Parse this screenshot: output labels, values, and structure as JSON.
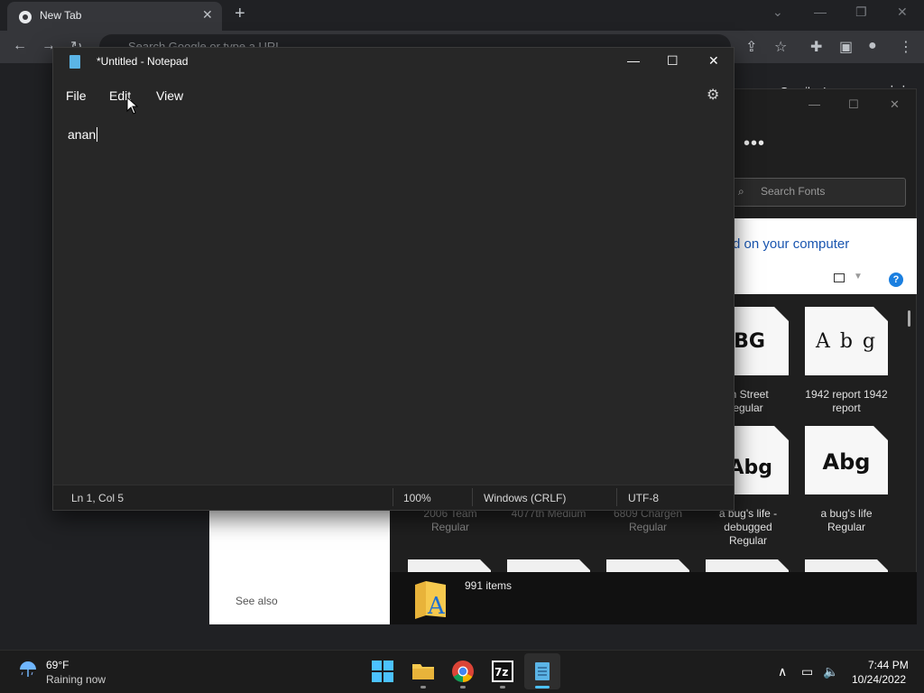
{
  "chrome": {
    "tab_title": "New Tab",
    "omnibox_placeholder": "Search Google or type a URL",
    "ntp_links": [
      "Gmail",
      "Images"
    ]
  },
  "fonts_window": {
    "search_placeholder": "Search Fonts",
    "heading_fragment": "d on your computer",
    "see_also": "See also",
    "items_count": "991 items",
    "tiles_row1": [
      {
        "sample": "ABG",
        "label": "th Street\negular"
      },
      {
        "sample": "A b g",
        "label": "1942 report 1942\nreport"
      }
    ],
    "tiles_row2": [
      {
        "sample": "Abg",
        "label": "a bug's life -\ndebugged\nRegular"
      },
      {
        "sample": "Abg",
        "label": "a bug's life\nRegular"
      }
    ],
    "behind_labels": [
      "2006 Team\nRegular",
      "4077th Medium",
      "6809 Chargen\nRegular"
    ]
  },
  "notepad": {
    "title": "*Untitled - Notepad",
    "menu": [
      "File",
      "Edit",
      "View"
    ],
    "content": "anan",
    "status": {
      "position": "Ln 1, Col 5",
      "zoom": "100%",
      "line_endings": "Windows (CRLF)",
      "encoding": "UTF-8"
    }
  },
  "taskbar": {
    "weather_temp": "69°F",
    "weather_condition": "Raining now",
    "time": "7:44 PM",
    "date": "10/24/2022"
  },
  "colors": {
    "notepad_bg": "#272727",
    "chrome_bg": "#202124",
    "accent_blue": "#1a56b0"
  }
}
